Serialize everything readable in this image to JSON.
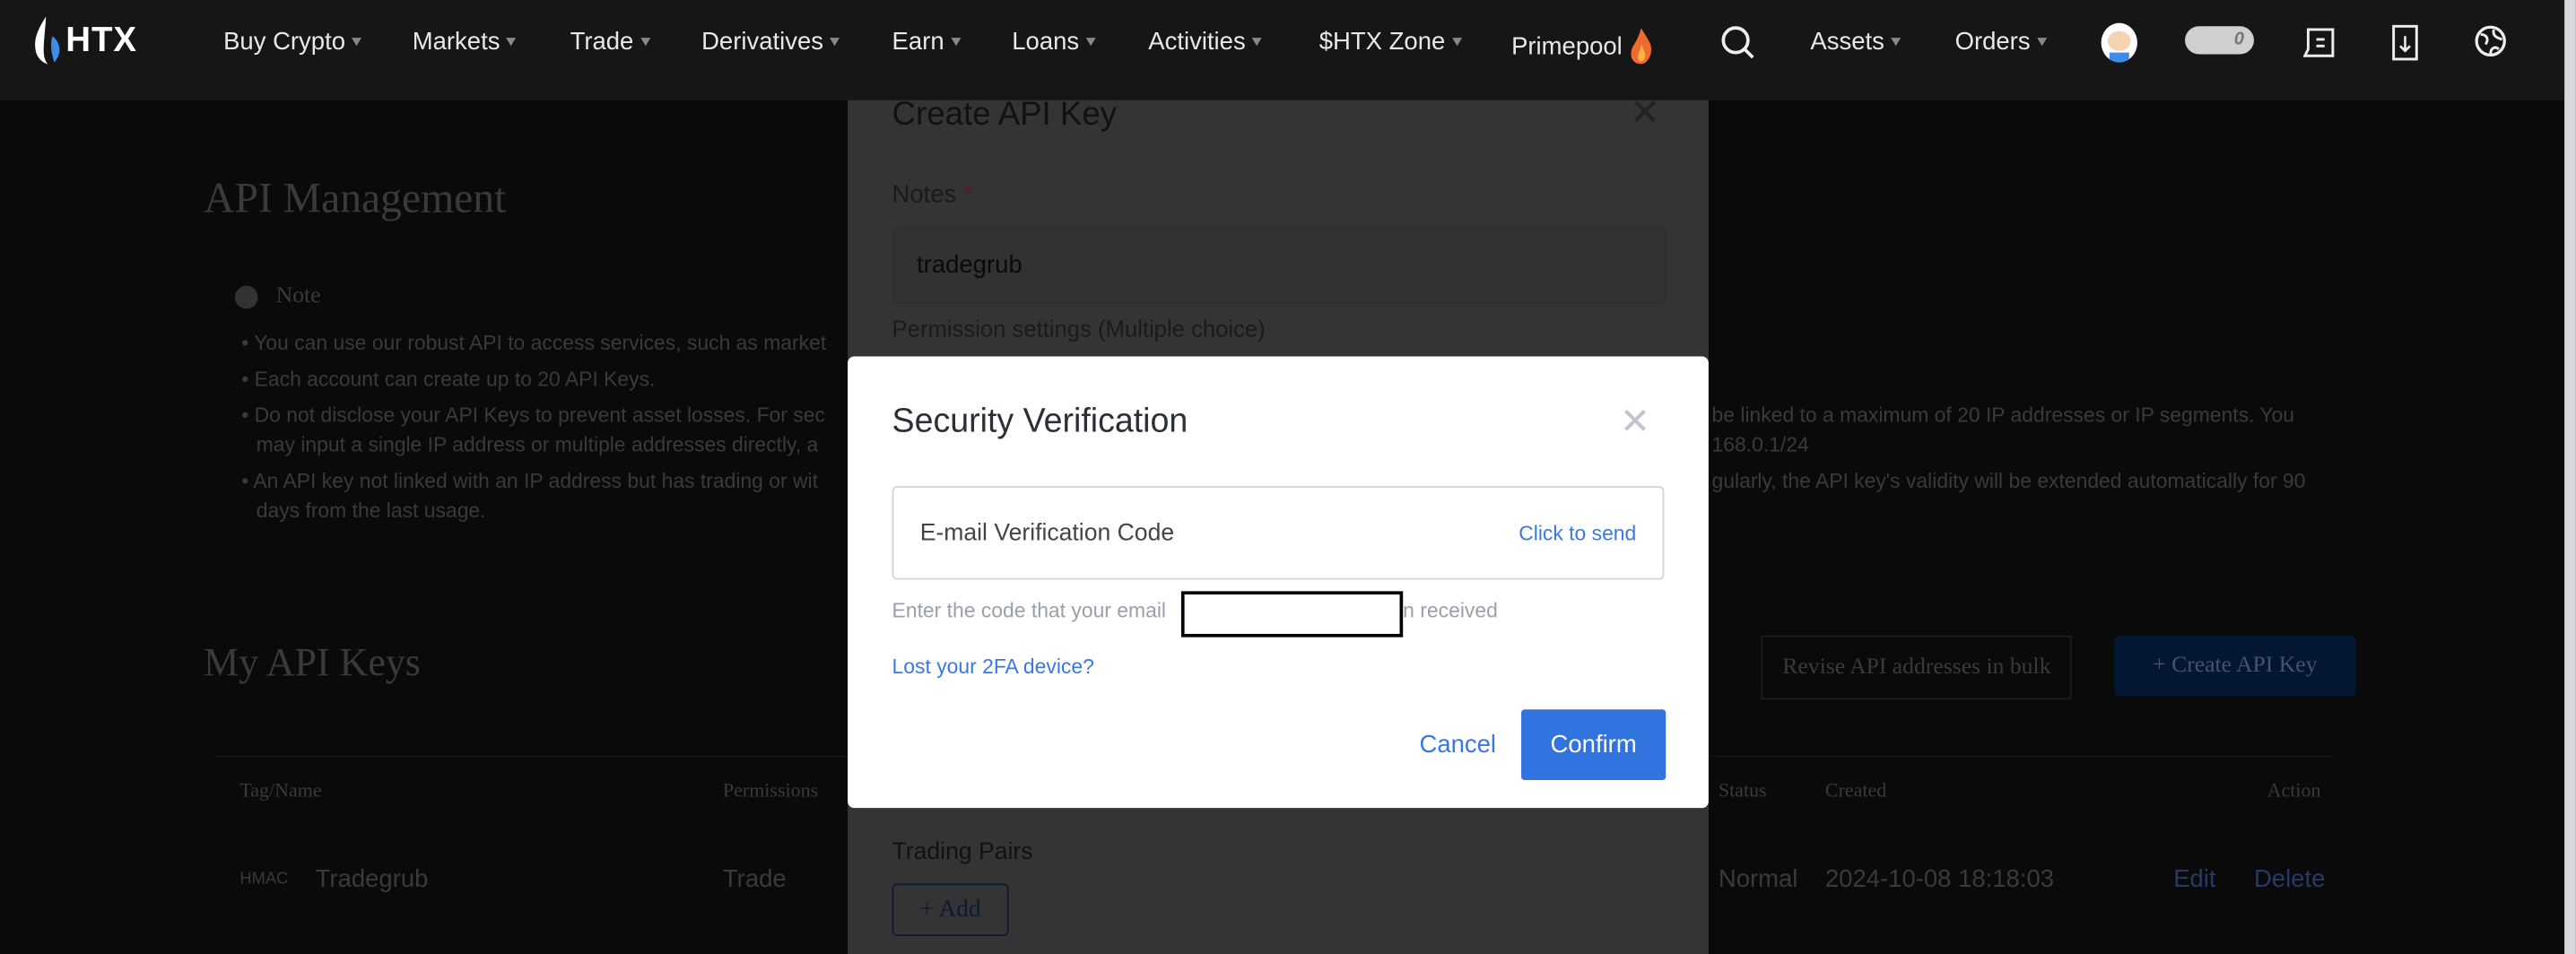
{
  "nav": {
    "logo": "HTX",
    "items": [
      "Buy Crypto",
      "Markets",
      "Trade",
      "Derivatives",
      "Earn",
      "Loans",
      "Activities",
      "$HTX Zone",
      "Primepool"
    ],
    "right_items": [
      "Assets",
      "Orders"
    ],
    "toggle_count": "0",
    "icons": [
      "search-icon",
      "avatar",
      "toggle",
      "message-icon",
      "download-icon",
      "globe-icon"
    ]
  },
  "page": {
    "title": "API Management",
    "note_title": "Note",
    "notes": [
      {
        "left": "You can use our robust API to access services, such as market",
        "right": ""
      },
      {
        "left": "Each account can create up to 20 API Keys.",
        "right": ""
      },
      {
        "left": "Do not disclose your API Keys to prevent asset losses. For sec",
        "right": "be linked to a maximum of 20 IP addresses or IP segments. You"
      },
      {
        "left": "may input a single IP address or multiple addresses directly, a",
        "right": "168.0.1/24"
      },
      {
        "left": "An API key not linked with an IP address but has trading or wit",
        "right": "gularly, the API key's validity will be extended automatically for 90"
      },
      {
        "left": "days from the last usage.",
        "right": ""
      }
    ],
    "my_keys_title": "My API Keys",
    "revise_button": "Revise API addresses in bulk",
    "create_button": "+ Create API Key",
    "table": {
      "headers": [
        "Tag/Name",
        "Permissions",
        "Status",
        "Created",
        "Action"
      ],
      "rows": [
        {
          "tag": "HMAC",
          "name": "Tradegrub",
          "permissions": "Trade",
          "status": "Normal",
          "created": "2024-10-08 18:18:03",
          "actions": [
            "Edit",
            "Delete"
          ]
        }
      ]
    }
  },
  "create_modal": {
    "title": "Create API Key",
    "notes_label": "Notes",
    "required_mark": "*",
    "notes_value": "tradegrub",
    "permission_label": "Permission settings (Multiple choice)",
    "trading_pairs_label": "Trading Pairs",
    "add_button": "+ Add"
  },
  "security_modal": {
    "title": "Security Verification",
    "email_code_placeholder": "E-mail Verification Code",
    "send_link": "Click to send",
    "hint_prefix": "Enter the code that your email",
    "hint_suffix": "n received",
    "lost_2fa": "Lost your 2FA device?",
    "cancel": "Cancel",
    "confirm": "Confirm"
  },
  "colors": {
    "accent": "#3174e0",
    "nav_bg": "#161616",
    "link": "#3a78e0"
  }
}
